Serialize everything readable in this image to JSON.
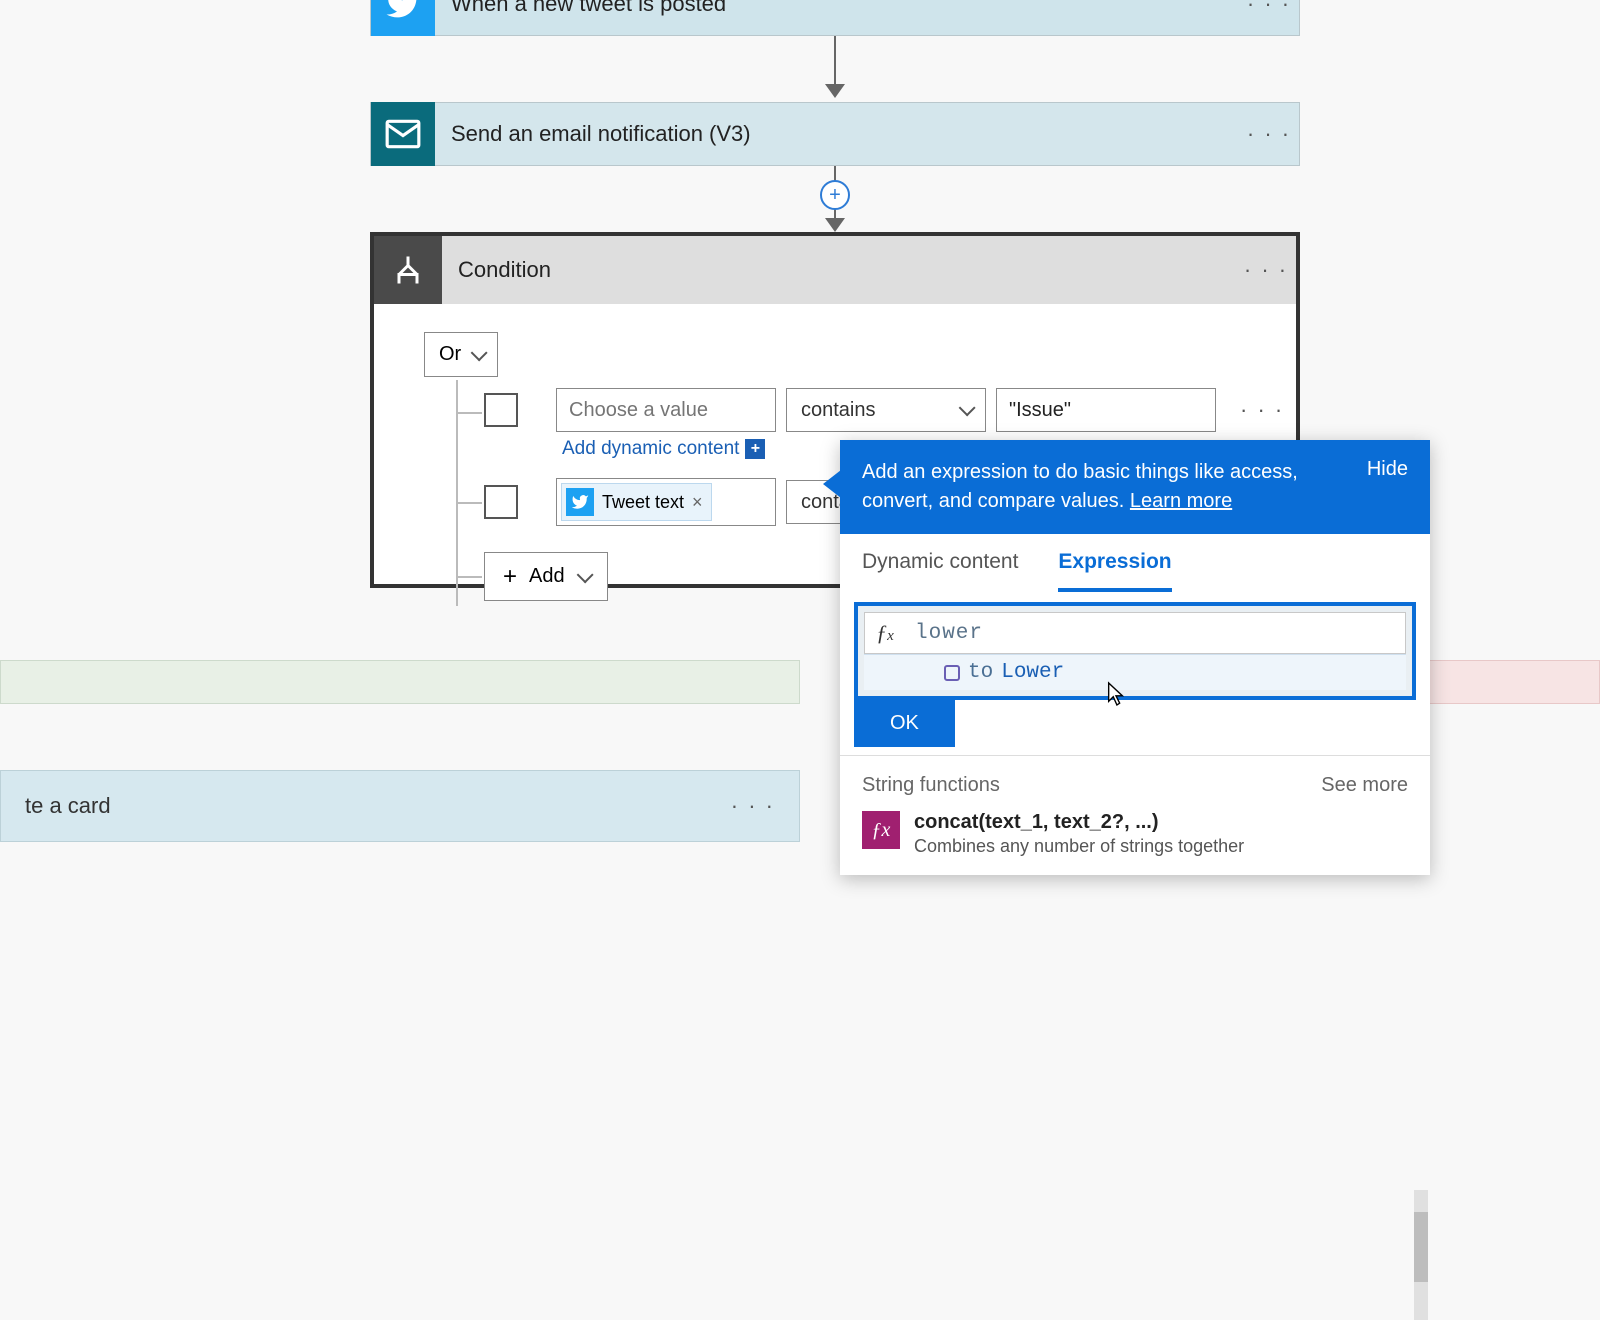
{
  "steps": {
    "twitter": {
      "title": "When a new tweet is posted"
    },
    "email": {
      "title": "Send an email notification (V3)"
    }
  },
  "condition": {
    "title": "Condition",
    "group_operator": "Or",
    "rows": [
      {
        "left_placeholder": "Choose a value",
        "operator": "contains",
        "right_value": "\"Issue\"",
        "add_dynamic_label": "Add dynamic content"
      },
      {
        "token_label": "Tweet text",
        "operator": "conta"
      }
    ],
    "add_button": "Add"
  },
  "branch": {
    "left_card": "te a card"
  },
  "flyout": {
    "message": "Add an expression to do basic things like access, convert, and compare values. ",
    "learn_more": "Learn more",
    "hide": "Hide",
    "tabs": {
      "dynamic": "Dynamic content",
      "expression": "Expression"
    },
    "expression_value": "lower",
    "suggestion_prefix": "to",
    "suggestion_match": "Lower",
    "ok": "OK",
    "functions": {
      "section": "String functions",
      "see_more": "See more",
      "items": [
        {
          "name": "concat(text_1, text_2?, ...)",
          "desc": "Combines any number of strings together"
        }
      ]
    }
  }
}
